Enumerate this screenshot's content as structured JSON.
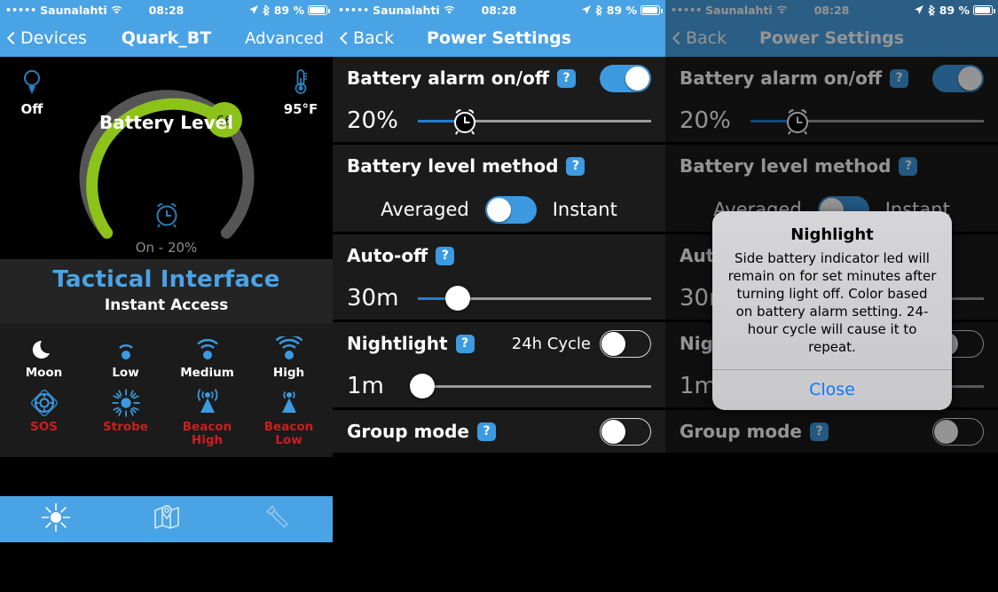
{
  "status_bar": {
    "signal_dots": "•••••",
    "carrier": "Saunalahti",
    "time": "08:28",
    "battery_text": "89 %"
  },
  "screen1": {
    "nav": {
      "back_label": "Devices",
      "title": "Quark_BT",
      "right_label": "Advanced"
    },
    "gauge": {
      "label": "Battery Level",
      "value": "66",
      "percent": 66,
      "left_corner": {
        "icon": "bulb-icon",
        "label": "Off"
      },
      "right_corner": {
        "icon": "thermometer-icon",
        "label": "95°F"
      },
      "alarm_icon": "alarm-clock-icon",
      "alarm_text": "On - 20%",
      "arc_color": "#8cc21a",
      "arc_track_color": "#555555"
    },
    "tactical": {
      "title": "Tactical Interface",
      "subtitle": "Instant Access"
    },
    "modes_row1": [
      {
        "label": "Moon",
        "icon": "moon-icon",
        "red": false
      },
      {
        "label": "Low",
        "icon": "signal-1-icon",
        "red": false
      },
      {
        "label": "Medium",
        "icon": "signal-2-icon",
        "red": false
      },
      {
        "label": "High",
        "icon": "signal-3-icon",
        "red": false
      }
    ],
    "modes_row2": [
      {
        "label": "SOS",
        "icon": "lifebuoy-icon",
        "red": true
      },
      {
        "label": "Strobe",
        "icon": "strobe-icon",
        "red": true
      },
      {
        "label": "Beacon\nHigh",
        "icon": "beacon-high-icon",
        "red": true
      },
      {
        "label": "Beacon\nLow",
        "icon": "beacon-low-icon",
        "red": true
      }
    ],
    "help_label": "?",
    "tabs": [
      {
        "icon": "brightness-sun-icon",
        "active": true
      },
      {
        "icon": "map-icon",
        "active": false
      },
      {
        "icon": "flashlight-icon",
        "active": false
      }
    ]
  },
  "screen2": {
    "nav": {
      "back_label": "Back",
      "title": "Power Settings"
    },
    "rows": [
      {
        "title": "Battery alarm on/off",
        "help": "?",
        "toggle_on": true,
        "slider": {
          "value_label": "20%",
          "percent": 20,
          "knob": "alarm-clock-icon",
          "fill": true
        }
      },
      {
        "title": "Battery level method",
        "help": "?",
        "segmented": {
          "left_label": "Averaged",
          "right_label": "Instant",
          "selected": "Averaged"
        }
      },
      {
        "title": "Auto-off",
        "help": "?",
        "slider": {
          "value_label": "30m",
          "percent": 17,
          "knob": "round",
          "fill": true
        }
      },
      {
        "title": "Nightlight",
        "help": "?",
        "side_label": "24h Cycle",
        "toggle_on": false,
        "slider": {
          "value_label": "1m",
          "percent": 2,
          "knob": "round",
          "fill": false
        }
      },
      {
        "title": "Group mode",
        "help": "?",
        "toggle_on": false
      }
    ]
  },
  "screen3": {
    "dialog": {
      "title": "Nighlight",
      "message": "Side battery indicator led will remain on for set minutes after turning light off. Color based on battery alarm setting. 24-hour cycle will cause it to repeat.",
      "close_label": "Close"
    }
  },
  "colors": {
    "accent": "#4aa3e5",
    "green": "#8cc21a",
    "red": "#cc1f1f",
    "link": "#0a78ff"
  }
}
